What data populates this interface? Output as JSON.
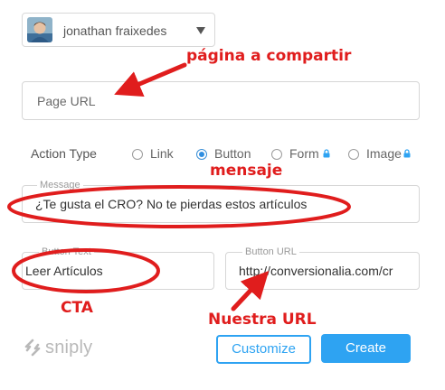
{
  "profile": {
    "name": "jonathan fraixedes",
    "avatar_icon": "user-avatar",
    "caret_icon": "chevron-down-icon"
  },
  "page_url": {
    "placeholder": "Page URL",
    "value": ""
  },
  "action_type": {
    "label": "Action Type",
    "options": [
      {
        "label": "Link",
        "selected": false,
        "locked": false
      },
      {
        "label": "Button",
        "selected": true,
        "locked": false
      },
      {
        "label": "Form",
        "selected": false,
        "locked": true
      },
      {
        "label": "Image",
        "selected": false,
        "locked": true
      }
    ]
  },
  "message": {
    "label": "Message",
    "value": "¿Te gusta el CRO? No te pierdas estos artículos"
  },
  "button_text": {
    "label": "Button Text",
    "value": "Leer Artículos"
  },
  "button_url": {
    "label": "Button URL",
    "value": "http://conversionalia.com/cr"
  },
  "footer": {
    "logo_text": "sniply",
    "customize_label": "Customize",
    "create_label": "Create"
  },
  "annotations": {
    "page_share": "página a compartir",
    "message": "mensaje",
    "cta": "CTA",
    "our_url": "Nuestra URL"
  },
  "colors": {
    "accent": "#2ea3f2",
    "annotation": "#e01d1d",
    "border": "#d6d6d6"
  }
}
